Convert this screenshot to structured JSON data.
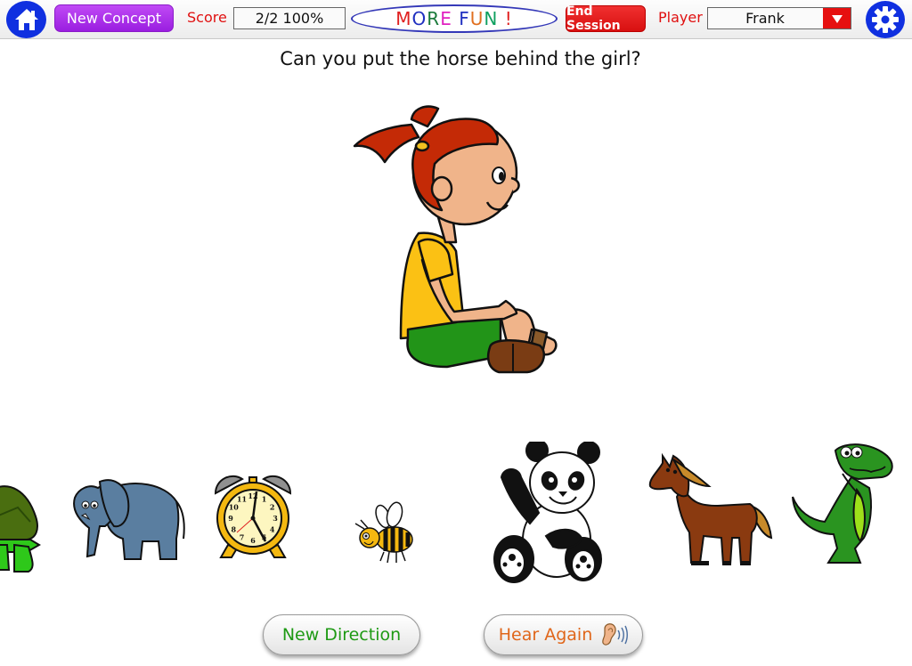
{
  "topbar": {
    "new_concept_label": "New Concept",
    "score_label": "Score",
    "score_value": "2/2  100%",
    "more_fun": {
      "letters": [
        {
          "char": "M",
          "color": "#e02020"
        },
        {
          "char": "O",
          "color": "#2030c0"
        },
        {
          "char": "R",
          "color": "#1a7a3a"
        },
        {
          "char": "E",
          "color": "#e020c0"
        },
        {
          "char": " ",
          "color": "#000000"
        },
        {
          "char": "F",
          "color": "#2030c0"
        },
        {
          "char": "U",
          "color": "#e07020"
        },
        {
          "char": "N",
          "color": "#10a060"
        },
        {
          "char": " ",
          "color": "#000000"
        },
        {
          "char": "!",
          "color": "#e02020"
        }
      ]
    },
    "end_session_label": "End Session",
    "player_label": "Player",
    "player_value": "Frank"
  },
  "question": "Can you put the horse behind the girl?",
  "scene": {
    "center_figure": "girl",
    "items": [
      "turtle",
      "elephant",
      "alarm-clock",
      "bee",
      "panda",
      "horse",
      "dinosaur"
    ]
  },
  "clock_numbers": [
    "12",
    "1",
    "2",
    "3",
    "4",
    "5",
    "6",
    "7",
    "8",
    "9",
    "10",
    "11"
  ],
  "buttons": {
    "new_direction_label": "New Direction",
    "hear_again_label": "Hear Again"
  },
  "colors": {
    "home_blue": "#1030e0",
    "new_concept_purple": "#a828e8",
    "score_red": "#e01010",
    "end_session_red": "#e01818",
    "new_direction_green": "#1e9a14",
    "hear_again_orange": "#e0661a"
  }
}
